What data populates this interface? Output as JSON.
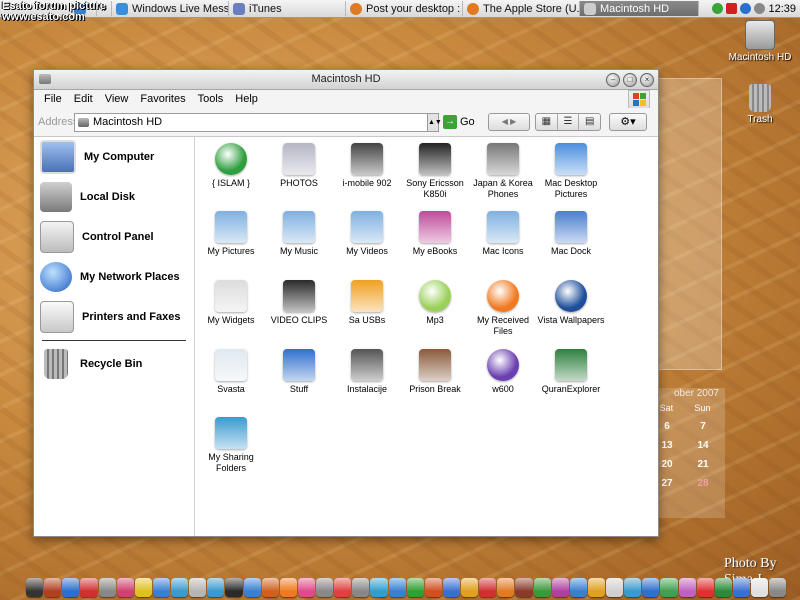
{
  "watermark": {
    "line1": "Esato forum picture",
    "line2": "www.esato.com"
  },
  "taskbar": {
    "items": [
      {
        "label": "Windows Live Mess...",
        "color": "#3a8ee0"
      },
      {
        "label": "iTunes",
        "color": "#6b7fbf"
      },
      {
        "label": "Post your desktop : ...",
        "color": "#e07b24"
      },
      {
        "label": "The Apple Store (U...",
        "color": "#e07b24"
      },
      {
        "label": "Macintosh HD",
        "color": "#cccccc"
      }
    ],
    "clock": "12:39"
  },
  "desktop_icons": [
    {
      "label": "Macintosh HD"
    },
    {
      "label": "Trash"
    }
  ],
  "window": {
    "title": "Macintosh HD",
    "menu": [
      "File",
      "Edit",
      "View",
      "Favorites",
      "Tools",
      "Help"
    ],
    "address_label": "Address",
    "address_value": "Macintosh HD",
    "go_label": "Go"
  },
  "left_panel": [
    {
      "label": "My Computer",
      "icon": "monitor-icon",
      "color": "#6c8fc8"
    },
    {
      "label": "Local Disk",
      "icon": "hard-drive-icon",
      "color": "#9a9a9a"
    },
    {
      "label": "Control Panel",
      "icon": "apple-logo-icon",
      "color": "#cfcfcf"
    },
    {
      "label": "My Network Places",
      "icon": "globe-icon",
      "color": "#2f6fcf"
    },
    {
      "label": "Printers and Faxes",
      "icon": "printer-icon",
      "color": "#e6e6e6"
    },
    {
      "label": "Recycle Bin",
      "icon": "trash-icon",
      "color": "#8a8a8a"
    }
  ],
  "items": [
    {
      "label": "{ ISLAM }",
      "icon": "crescent-icon",
      "color": "#2e9e3e"
    },
    {
      "label": "PHOTOS",
      "icon": "camera-drive-icon",
      "color": "#b5b5c5"
    },
    {
      "label": "i-mobile 902",
      "icon": "phone-icon",
      "color": "#444444"
    },
    {
      "label": "Sony Ericsson K850i",
      "icon": "phone-icon",
      "color": "#222222"
    },
    {
      "label": "Japan & Korea Phones",
      "icon": "camera-icon",
      "color": "#777777"
    },
    {
      "label": "Mac Desktop Pictures",
      "icon": "finder-icon",
      "color": "#4a8fe0"
    },
    {
      "label": "My Pictures",
      "icon": "folder-icon",
      "color": "#7fb0e0"
    },
    {
      "label": "My Music",
      "icon": "folder-music-icon",
      "color": "#7fb0e0"
    },
    {
      "label": "My Videos",
      "icon": "folder-video-icon",
      "color": "#7fb0e0"
    },
    {
      "label": "My eBooks",
      "icon": "books-icon",
      "color": "#c04a9a"
    },
    {
      "label": "Mac Icons",
      "icon": "folder-x-icon",
      "color": "#7fb0e0"
    },
    {
      "label": "Mac Dock",
      "icon": "desktop-icon",
      "color": "#4a7fd0"
    },
    {
      "label": "My Widgets",
      "icon": "imac-icon",
      "color": "#dcdcdc"
    },
    {
      "label": "VIDEO CLIPS",
      "icon": "clapper-icon",
      "color": "#2a2a2a"
    },
    {
      "label": "Sa USBs",
      "icon": "usb-drive-icon",
      "color": "#f0a020"
    },
    {
      "label": "Mp3",
      "icon": "cd-music-icon",
      "color": "#9ad05a"
    },
    {
      "label": "My Received Files",
      "icon": "sync-icon",
      "color": "#f07a20"
    },
    {
      "label": "Vista Wallpapers",
      "icon": "windows-orb-icon",
      "color": "#1f4f9a"
    },
    {
      "label": "Svasta",
      "icon": "blank-doc-icon",
      "color": "#e0e8f0"
    },
    {
      "label": "Stuff",
      "icon": "bluetooth-icon",
      "color": "#2f6fcf"
    },
    {
      "label": "Instalacije",
      "icon": "app-store-icon",
      "color": "#555555"
    },
    {
      "label": "Prison Break",
      "icon": "movie-icon",
      "color": "#8a5a3a"
    },
    {
      "label": "w600",
      "icon": "heart-orb-icon",
      "color": "#6a3fb0"
    },
    {
      "label": "QuranExplorer",
      "icon": "book-green-icon",
      "color": "#2f7f3f"
    },
    {
      "label": "My Sharing Folders",
      "icon": "users-icon",
      "color": "#3a9ad0"
    }
  ],
  "calendar": {
    "title": "ober 2007",
    "days": [
      "Sat",
      "Sun"
    ],
    "rows": [
      [
        "6",
        "7"
      ],
      [
        "13",
        "14"
      ],
      [
        "20",
        "21"
      ],
      [
        "27",
        "28"
      ]
    ]
  },
  "credit": "Photo By Sima J",
  "dock_colors": [
    "#333333",
    "#b04020",
    "#2a6fd0",
    "#d03030",
    "#888888",
    "#d04070",
    "#e0c020",
    "#3a7fd0",
    "#3a9ad0",
    "#b5b5b5",
    "#3a9ad0",
    "#2a2a2a",
    "#3a7fd0",
    "#d06020",
    "#f07a20",
    "#e04a8a",
    "#888888",
    "#e04040",
    "#888888",
    "#2f9fd0",
    "#3a7fd0",
    "#30a030",
    "#d05020",
    "#3a6fd0",
    "#e0a020",
    "#d03030",
    "#e07b24",
    "#8a3a2a",
    "#3a9a3a",
    "#b040a0",
    "#3a7fd0",
    "#e0a020",
    "#d0d0d0",
    "#3a9ad0",
    "#2f6fcf",
    "#40a050",
    "#c060c0",
    "#e03030",
    "#2a8a3a",
    "#3a6fd0",
    "#e0e0e0",
    "#888888"
  ]
}
